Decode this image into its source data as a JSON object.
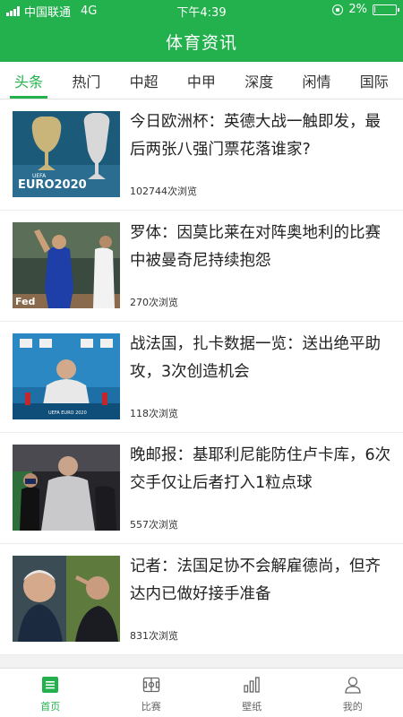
{
  "status_bar": {
    "carrier": "中国联通",
    "network": "4G",
    "time": "下午4:39",
    "battery_text": "2%",
    "battery_level": 0.02
  },
  "header": {
    "title": "体育资讯"
  },
  "tabs": [
    {
      "label": "头条",
      "active": true
    },
    {
      "label": "热门"
    },
    {
      "label": "中超"
    },
    {
      "label": "中甲"
    },
    {
      "label": "深度"
    },
    {
      "label": "闲情"
    },
    {
      "label": "国际"
    }
  ],
  "articles": [
    {
      "title": "今日欧洲杯：英德大战一触即发，最后两张八强门票花落谁家?",
      "views": "102744次浏览",
      "image": "euro-2020-trophy",
      "image_text": "EURO2020",
      "image_subtext": "UEFA"
    },
    {
      "title": "罗体：因莫比莱在对阵奥地利的比赛中被曼奇尼持续抱怨",
      "views": "270次浏览",
      "image": "italy-player-celebrating"
    },
    {
      "title": "战法国，扎卡数据一览：送出绝平助攻，3次创造机会",
      "views": "118次浏览",
      "image": "press-conference",
      "image_text": "UEFA EURO 2020"
    },
    {
      "title": "晚邮报：基耶利尼能防住卢卡库，6次交手仅让后者打入1粒点球",
      "views": "557次浏览",
      "image": "chiellini-photo"
    },
    {
      "title": "记者：法国足协不会解雇德尚，但齐达内已做好接手准备",
      "views": "831次浏览",
      "image": "deschamps-zidane"
    }
  ],
  "bottom_nav": [
    {
      "label": "首页",
      "icon": "home-icon",
      "active": true
    },
    {
      "label": "比赛",
      "icon": "pitch-icon"
    },
    {
      "label": "壁纸",
      "icon": "bars-icon"
    },
    {
      "label": "我的",
      "icon": "user-icon"
    }
  ],
  "colors": {
    "accent": "#22b14c",
    "background": "#f2f2f2",
    "text": "#222222"
  }
}
